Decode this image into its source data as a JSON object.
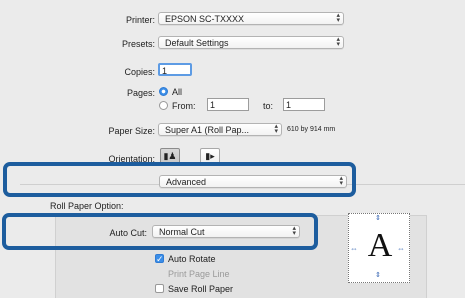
{
  "printer": {
    "label": "Printer:",
    "value": "EPSON SC-TXXXX"
  },
  "presets": {
    "label": "Presets:",
    "value": "Default Settings"
  },
  "copies": {
    "label": "Copies:",
    "value": "1"
  },
  "pages": {
    "label": "Pages:",
    "all_label": "All",
    "from_label": "From:",
    "from_value": "1",
    "to_label": "to:",
    "to_value": "1"
  },
  "paper_size": {
    "label": "Paper Size:",
    "value": "Super A1 (Roll Pap...",
    "dimensions": "610 by 914 mm"
  },
  "orientation": {
    "label": "Orientation:"
  },
  "panel_select": {
    "value": "Advanced"
  },
  "roll_paper": {
    "section_label": "Roll Paper Option:",
    "auto_cut_label": "Auto Cut:",
    "auto_cut_value": "Normal Cut",
    "auto_rotate_label": "Auto Rotate",
    "print_page_line_label": "Print Page Line",
    "save_roll_paper_label": "Save Roll Paper"
  },
  "preview": {
    "glyph": "A"
  },
  "colors": {
    "highlight": "#1d5d9e",
    "accent": "#3b8ee8"
  }
}
